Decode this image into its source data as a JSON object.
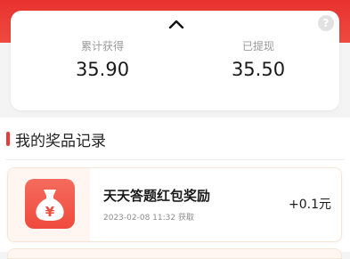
{
  "summary": {
    "total_label": "累计获得",
    "total_value": "35.90",
    "withdrawn_label": "已提现",
    "withdrawn_value": "35.50",
    "help_glyph": "?"
  },
  "section": {
    "title": "我的奖品记录"
  },
  "records": [
    {
      "icon": "money-bag-icon",
      "title": "天天答题红包奖励",
      "time": "2023-02-08 11:32 获取",
      "amount": "+0.1元"
    }
  ],
  "colors": {
    "brand_red": "#e8322f",
    "accent_bar": "#ee3a36",
    "icon_bg": "#ef4a3e"
  }
}
